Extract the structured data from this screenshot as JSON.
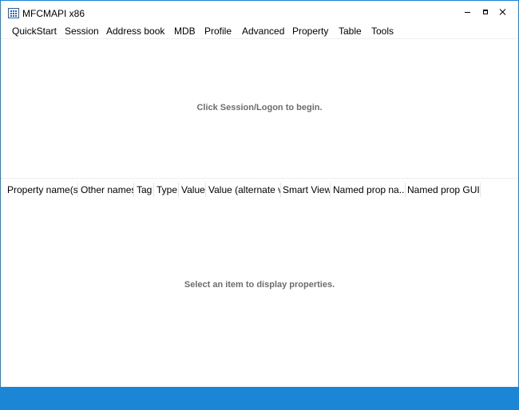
{
  "window": {
    "title": "MFCMAPI x86"
  },
  "menu": {
    "items": [
      "QuickStart",
      "Session",
      "Address book",
      "MDB",
      "Profile",
      "Advanced",
      "Property",
      "Table",
      "Tools"
    ]
  },
  "top_pane": {
    "message": "Click Session/Logon to begin."
  },
  "property_list": {
    "columns": [
      "Property name(s)",
      "Other names",
      "Tag",
      "Type",
      "Value",
      "Value (alternate v...",
      "Smart View",
      "Named prop na...",
      "Named prop GUI..."
    ],
    "empty_message": "Select an item to display properties."
  },
  "colors": {
    "window_border": "#1883d7",
    "taskbar": "#1c86d6",
    "placeholder_text": "#6d6d6d"
  }
}
